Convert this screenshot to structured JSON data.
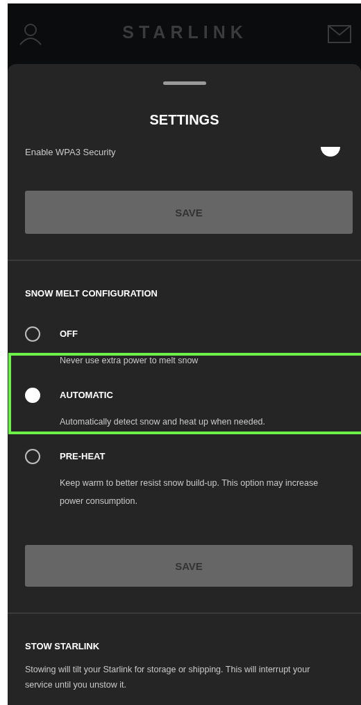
{
  "header": {
    "title": "STARLINK"
  },
  "sheet": {
    "title": "SETTINGS",
    "wpa3": {
      "label": "Enable WPA3 Security",
      "on": true
    },
    "save_buttons": [
      "SAVE",
      "SAVE"
    ],
    "snow_melt": {
      "heading": "SNOW MELT CONFIGURATION",
      "options": [
        {
          "label": "OFF",
          "description": "Never use extra power to melt snow",
          "selected": false,
          "highlighted": false
        },
        {
          "label": "AUTOMATIC",
          "description": "Automatically detect snow and heat up when needed.",
          "selected": true,
          "highlighted": true
        },
        {
          "label": "PRE-HEAT",
          "description": "Keep warm to better resist snow build-up. This option may increase power consumption.",
          "selected": false,
          "highlighted": false
        }
      ]
    },
    "stow": {
      "heading": "STOW STARLINK",
      "description": "Stowing will tilt your Starlink for storage or shipping. This will interrupt your service until you unstow it."
    }
  }
}
